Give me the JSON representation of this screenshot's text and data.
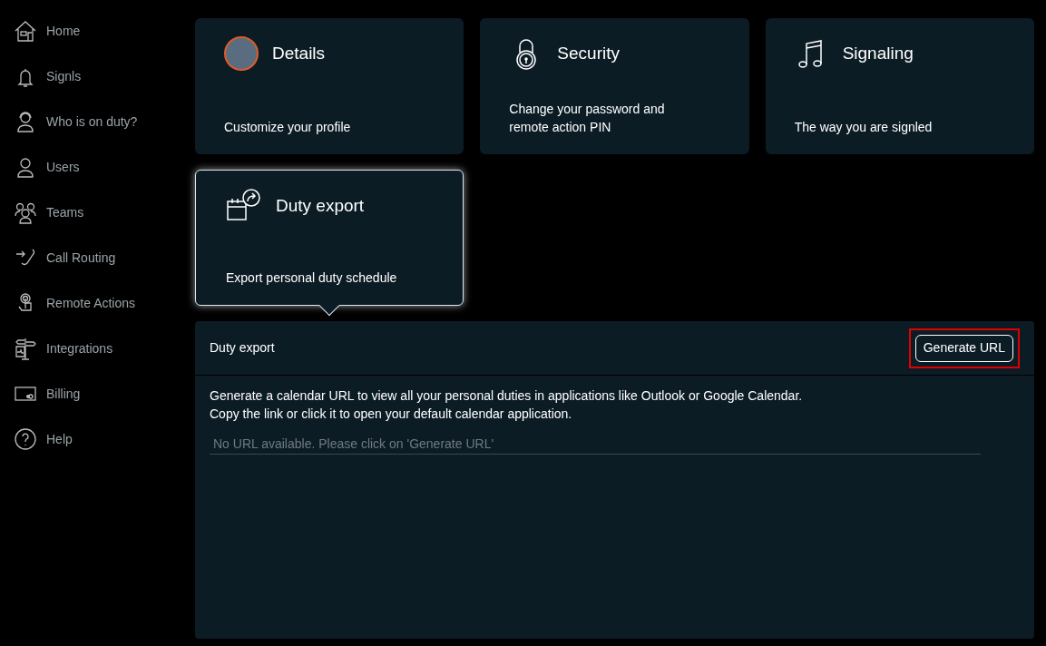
{
  "sidebar": {
    "items": [
      {
        "label": "Home"
      },
      {
        "label": "Signls"
      },
      {
        "label": "Who is on duty?"
      },
      {
        "label": "Users"
      },
      {
        "label": "Teams"
      },
      {
        "label": "Call Routing"
      },
      {
        "label": "Remote Actions"
      },
      {
        "label": "Integrations"
      },
      {
        "label": "Billing"
      },
      {
        "label": "Help"
      }
    ]
  },
  "cards": [
    {
      "title": "Details",
      "description": "Customize your profile",
      "selected": false
    },
    {
      "title": "Security",
      "description": "Change your password and remote action PIN",
      "selected": false
    },
    {
      "title": "Signaling",
      "description": "The way you are signled",
      "selected": false
    },
    {
      "title": "Duty export",
      "description": "Export personal duty schedule",
      "selected": true
    }
  ],
  "panel": {
    "title": "Duty export",
    "button": {
      "label": "Generate URL",
      "highlighted": true
    },
    "description": [
      "Generate a calendar URL to view all your personal duties in applications like Outlook or Google Calendar.",
      "Copy the link or click it to open your default calendar application."
    ],
    "url_field": {
      "placeholder": "No URL available. Please click on 'Generate URL'"
    }
  }
}
